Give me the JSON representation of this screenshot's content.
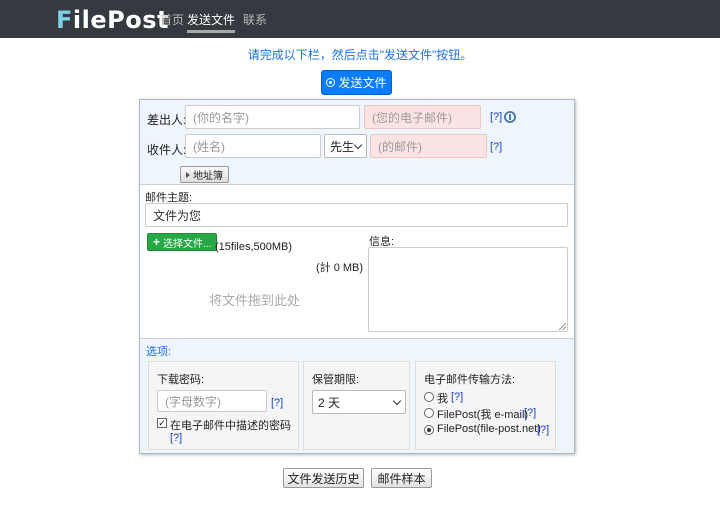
{
  "header": {
    "logo_first": "F",
    "logo_rest": "ilePost",
    "nav": [
      {
        "label": "首页"
      },
      {
        "label": "发送文件"
      },
      {
        "label": "联系"
      }
    ]
  },
  "instruction": "请完成以下栏，然后点击\"发送文件\"按钮。",
  "send_button": "发送文件",
  "sender": {
    "label": "差出人:",
    "name_placeholder": "(你的名字)",
    "email_placeholder": "(您的电子邮件)",
    "help": "[?]"
  },
  "recipient": {
    "label": "收件人:",
    "name_placeholder": "(姓名)",
    "title_value": "先生",
    "email_placeholder": "(的邮件)",
    "help": "[?]"
  },
  "address_book": "地址簿",
  "subject": {
    "label": "邮件主题:",
    "value": "文件为您"
  },
  "choose_file": {
    "label": "选择文件...",
    "limit": "(15files,500MB)",
    "total": "(計 0 MB)"
  },
  "dropzone": "将文件拖到此处",
  "message": {
    "label": "信息:"
  },
  "options": {
    "title": "选项:",
    "password": {
      "label": "下载密码:",
      "placeholder": "(字母数字)",
      "help": "[?]",
      "checkbox_label": "在电子邮件中描述的密码",
      "checkbox_help": "[?]",
      "checked": true
    },
    "retention": {
      "label": "保管期限:",
      "value": "2 天"
    },
    "delivery": {
      "label": "电子邮件传输方法:",
      "choices": [
        {
          "label": "我",
          "help": "[?]"
        },
        {
          "label": "FilePost(我 e-mail)",
          "help": "[?]"
        },
        {
          "label": "FilePost(file-post.net)",
          "help": "[?]"
        }
      ],
      "selected": 2
    }
  },
  "footer": {
    "history": "文件发送历史",
    "sample": "邮件样本"
  },
  "colors": {
    "topbar": "#343a40",
    "accent_blue": "#0a7cff",
    "green": "#28a745",
    "pink_field": "#fde4e4",
    "panel_bg": "#eef5fc"
  }
}
